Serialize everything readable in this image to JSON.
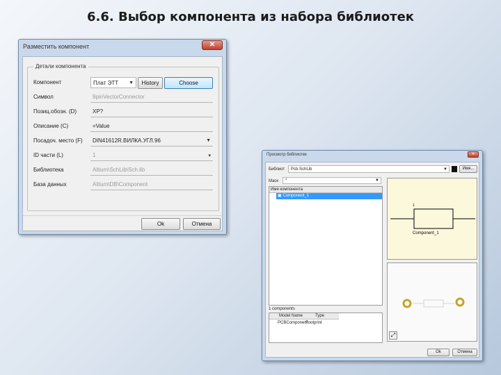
{
  "slide_title": "6.6. Выбор компонента из набора библиотек",
  "place_dialog": {
    "title": "Разместить компонент",
    "close_label": "✕",
    "group_caption": "Детали компонента",
    "component": {
      "label": "Компонент",
      "value": "Плат ЭТТ",
      "history_label": "History",
      "choose_label": "Choose"
    },
    "symbol": {
      "label": "Символ",
      "value": "9pinVectorConnector"
    },
    "designator": {
      "label": "Позиц.обозн. (D)",
      "value": "XP?"
    },
    "description": {
      "label": "Описание (C)",
      "value": "=Value"
    },
    "footprint": {
      "label": "Посадоч. место (F)",
      "value": "DIN41612R.ВИЛКА.УГЛ.96"
    },
    "part_id": {
      "label": "ID части (L)",
      "value": "1"
    },
    "library": {
      "label": "Библиотека",
      "value": "Altium\\SchLib\\Sch.lib"
    },
    "database": {
      "label": "База данных",
      "value": "Altium\\DB\\Component"
    },
    "ok_label": "Ok",
    "cancel_label": "Отмена"
  },
  "browse_dialog": {
    "title": "Просмотр библиотек",
    "library_label": "Библиот",
    "library_value": "Pcb.SchLib",
    "library_button": "Имя...",
    "mask_label": "Маск",
    "mask_value": "*",
    "list_header": "Имя компонента",
    "list_items": [
      "Component_1"
    ],
    "components_count": "1 components",
    "table_headers": [
      "Model Name",
      "Type"
    ],
    "table_rows": [
      [
        "PCBComponent",
        "Footprint"
      ]
    ],
    "symbol_preview_label": "Component_1",
    "symbol_preview_pin": "1",
    "ok_label": "Ok",
    "cancel_label": "Отмена"
  },
  "colors": {
    "title_bar": "#c9d8ea",
    "close_red": "#c1402a",
    "selection_blue": "#3399ff",
    "preview_bg": "#fbf8dc",
    "pad_gold": "#c9a227"
  }
}
